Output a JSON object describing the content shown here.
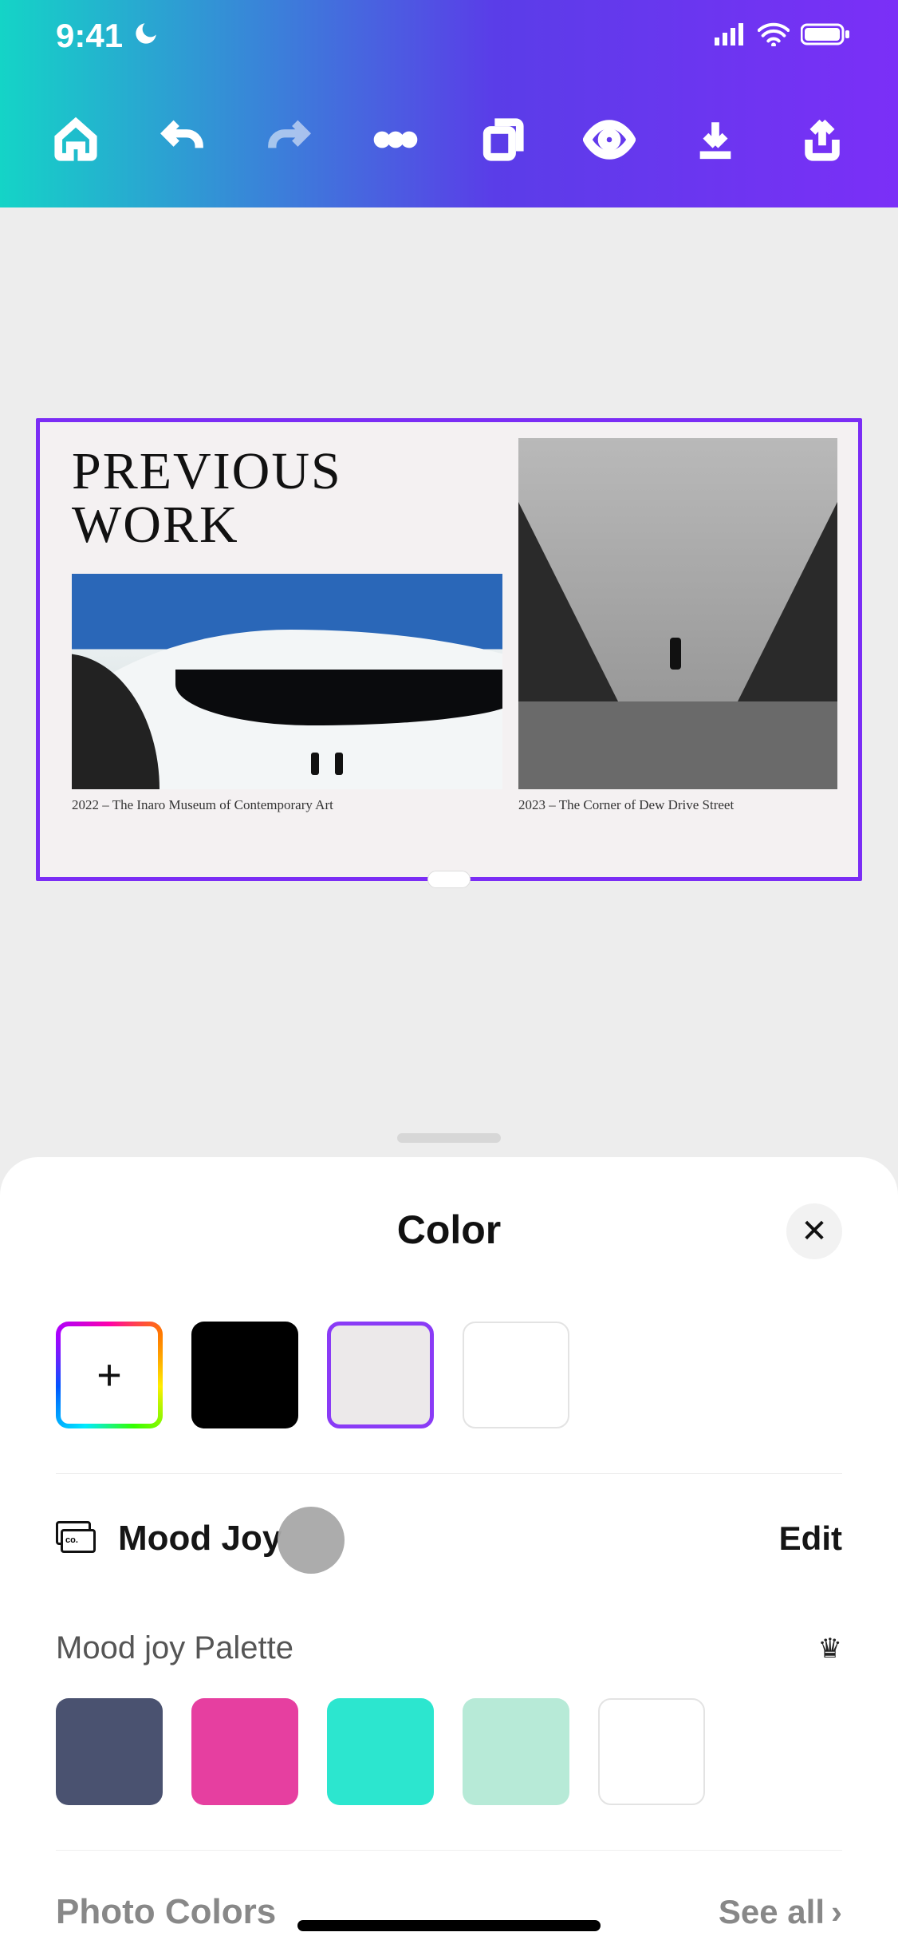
{
  "status": {
    "time": "9:41"
  },
  "canvas": {
    "title_line1": "PREVIOUS",
    "title_line2": "WORK",
    "caption_left": "2022 – The Inaro Museum of Contemporary Art",
    "caption_right": "2023 – The Corner of Dew Drive Street"
  },
  "sheet": {
    "title": "Color",
    "doc_colors": [
      {
        "type": "add"
      },
      {
        "type": "solid",
        "hex": "#000000"
      },
      {
        "type": "solid",
        "hex": "#ece9ea",
        "selected": true
      },
      {
        "type": "solid",
        "hex": "#ffffff",
        "bordered": true
      }
    ],
    "brand_kit": {
      "name": "Mood Joy",
      "edit_label": "Edit"
    },
    "palette": {
      "title": "Mood joy Palette",
      "colors": [
        "#4a5270",
        "#e63fa0",
        "#2ce6cf",
        "#b7ead7",
        "#ffffff"
      ]
    },
    "photo_colors": {
      "title": "Photo Colors",
      "see_all": "See all"
    }
  }
}
